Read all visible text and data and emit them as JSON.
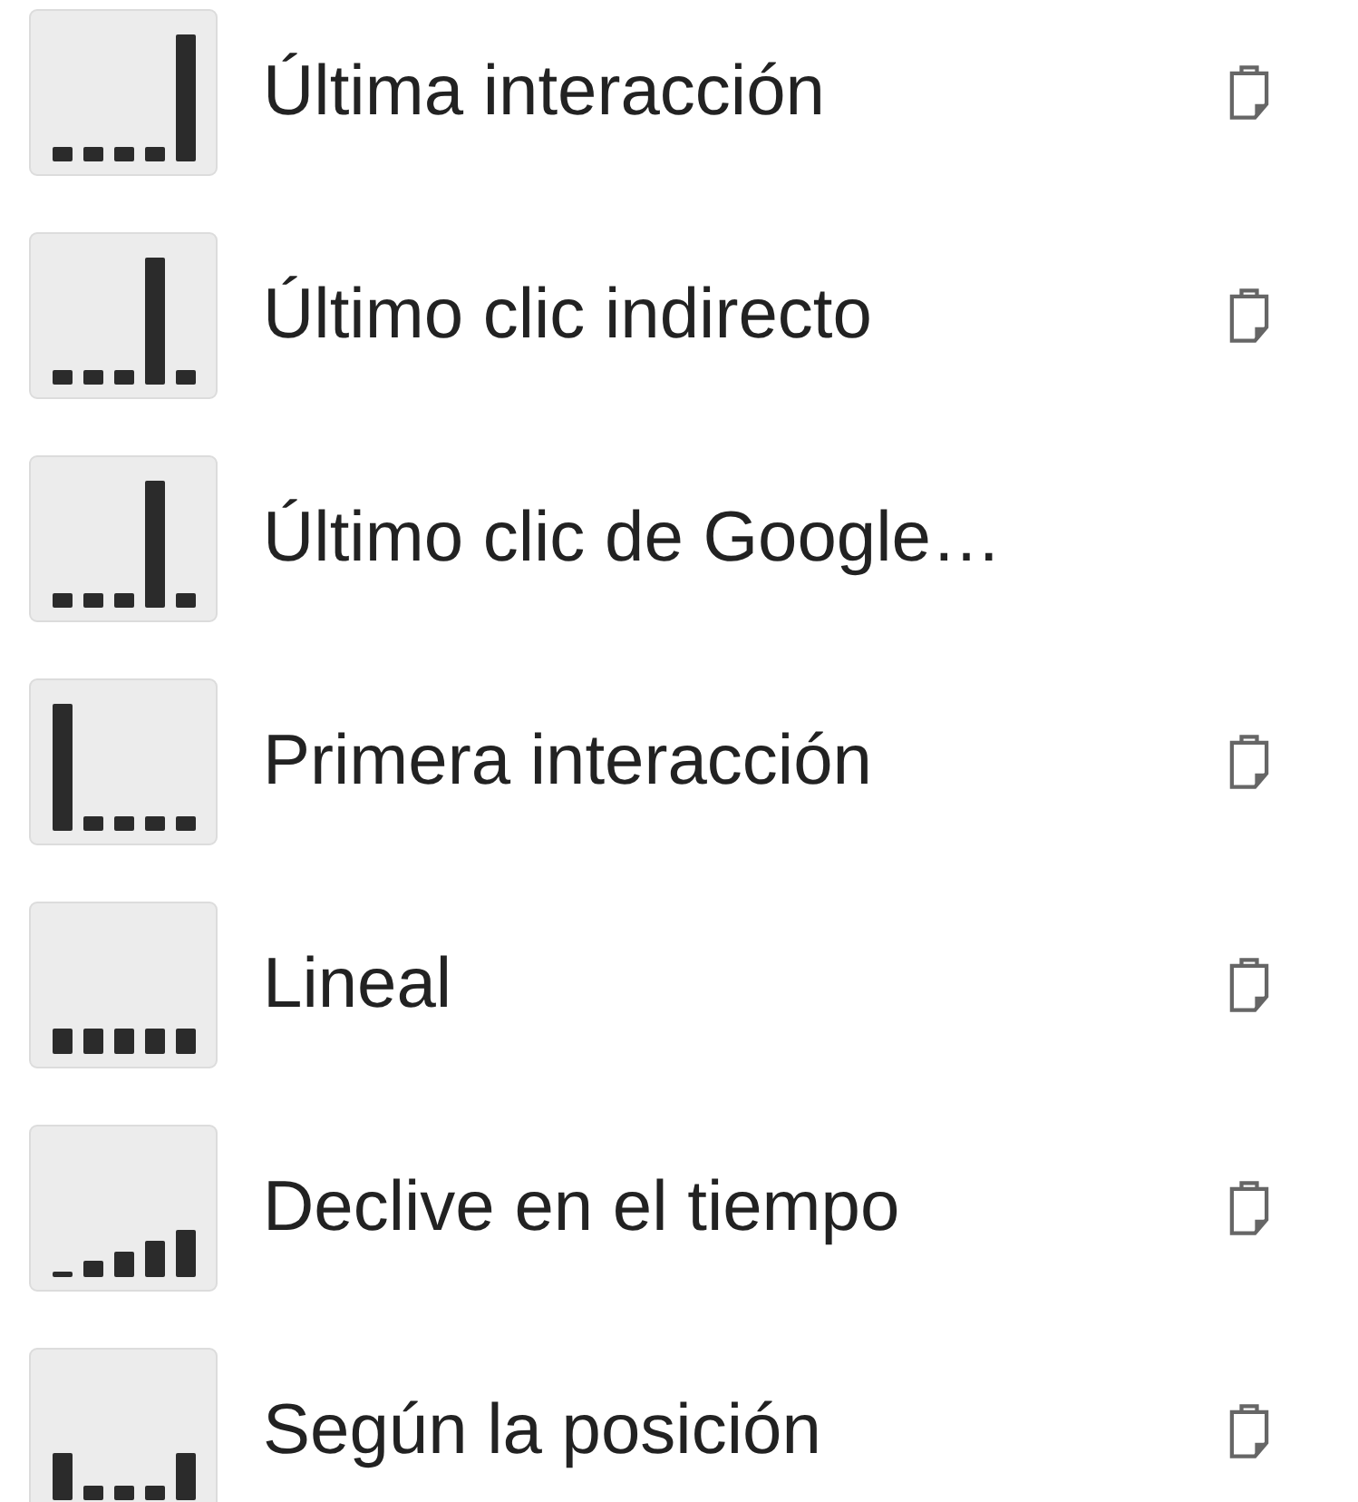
{
  "models": [
    {
      "kind": "last",
      "label": "Última interacción",
      "copyable": true
    },
    {
      "kind": "last_indirect",
      "label": "Último clic indirecto",
      "copyable": true
    },
    {
      "kind": "last_indirect",
      "label": "Último clic de Google…",
      "copyable": false
    },
    {
      "kind": "first",
      "label": "Primera interacción",
      "copyable": true
    },
    {
      "kind": "linear",
      "label": "Lineal",
      "copyable": true
    },
    {
      "kind": "time_decay",
      "label": "Declive en el tiempo",
      "copyable": true
    },
    {
      "kind": "position",
      "label": "Según la posición",
      "copyable": true
    }
  ]
}
